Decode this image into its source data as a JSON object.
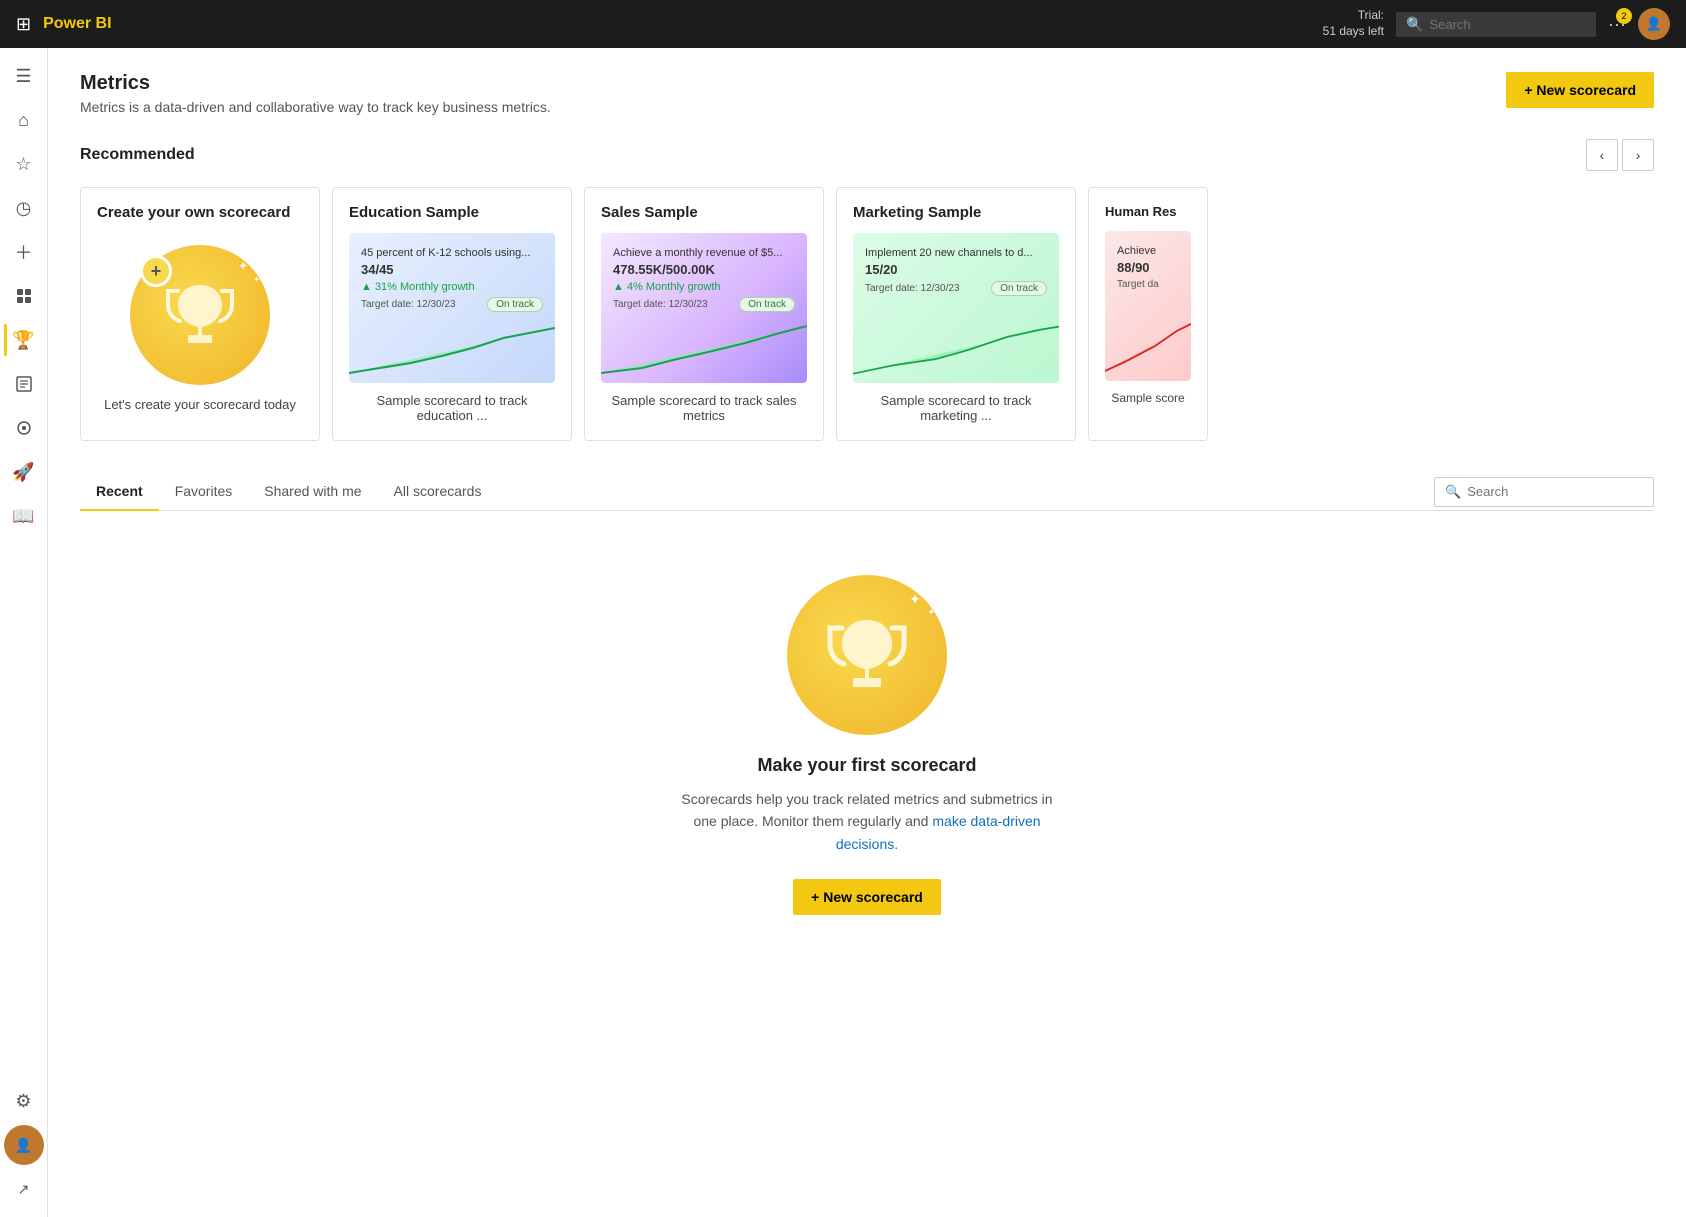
{
  "topbar": {
    "logo": "Power BI",
    "trial_line1": "Trial:",
    "trial_line2": "51 days left",
    "search_placeholder": "Search",
    "notif_count": "2"
  },
  "sidebar": {
    "items": [
      {
        "id": "menu",
        "icon": "☰",
        "label": "Menu"
      },
      {
        "id": "home",
        "icon": "⌂",
        "label": "Home"
      },
      {
        "id": "favorites",
        "icon": "★",
        "label": "Favorites"
      },
      {
        "id": "recent",
        "icon": "◷",
        "label": "Recent"
      },
      {
        "id": "create",
        "icon": "+",
        "label": "Create"
      },
      {
        "id": "data",
        "icon": "⬛",
        "label": "Data hub"
      },
      {
        "id": "metrics",
        "icon": "🏆",
        "label": "Metrics",
        "active": true
      },
      {
        "id": "reports",
        "icon": "▦",
        "label": "Reports"
      },
      {
        "id": "monitor",
        "icon": "👁",
        "label": "Monitor"
      },
      {
        "id": "deploy",
        "icon": "🚀",
        "label": "Deploy"
      },
      {
        "id": "learn",
        "icon": "📖",
        "label": "Learn"
      },
      {
        "id": "settings",
        "icon": "⚙",
        "label": "Settings"
      },
      {
        "id": "avatar",
        "icon": "👤",
        "label": "Profile"
      }
    ]
  },
  "page": {
    "title": "Metrics",
    "subtitle": "Metrics is a data-driven and collaborative way to track key business metrics.",
    "new_scorecard_label": "+ New scorecard"
  },
  "recommended": {
    "section_title": "Recommended",
    "cards": [
      {
        "id": "create-own",
        "title": "Create your own scorecard",
        "description": "Let's create your scorecard today",
        "type": "create"
      },
      {
        "id": "education",
        "title": "Education Sample",
        "description": "Sample scorecard to track education ...",
        "metric_text": "45 percent of K-12 schools using...",
        "metric_count": "34/45",
        "growth": "31% Monthly growth",
        "target_date": "Target date: 12/30/23",
        "status": "On track",
        "bg": "blue"
      },
      {
        "id": "sales",
        "title": "Sales Sample",
        "description": "Sample scorecard to track sales metrics",
        "metric_text": "Achieve a monthly revenue of $5...",
        "metric_count": "478.55K/500.00K",
        "growth": "4% Monthly growth",
        "target_date": "Target date: 12/30/23",
        "status": "On track",
        "bg": "purple"
      },
      {
        "id": "marketing",
        "title": "Marketing Sample",
        "description": "Sample scorecard to track marketing ...",
        "metric_text": "Implement 20 new channels to d...",
        "metric_count": "15/20",
        "growth": "",
        "target_date": "Target date: 12/30/23",
        "status": "On track",
        "bg": "green"
      },
      {
        "id": "human-res",
        "title": "Human Res",
        "description": "Sample score",
        "metric_text": "Achieve",
        "metric_count": "88/90",
        "growth": "",
        "target_date": "Target da",
        "status": "",
        "bg": "pink"
      }
    ]
  },
  "tabs": {
    "items": [
      {
        "id": "recent",
        "label": "Recent",
        "active": true
      },
      {
        "id": "favorites",
        "label": "Favorites",
        "active": false
      },
      {
        "id": "shared",
        "label": "Shared with me",
        "active": false
      },
      {
        "id": "all",
        "label": "All scorecards",
        "active": false
      }
    ],
    "search_placeholder": "Search"
  },
  "empty_state": {
    "title": "Make your first scorecard",
    "subtitle": "Scorecards help you track related metrics and submetrics in one place. Monitor them regularly and make data-driven decisions.",
    "subtitle_link_text": "make data-driven decisions.",
    "btn_label": "+ New scorecard"
  }
}
